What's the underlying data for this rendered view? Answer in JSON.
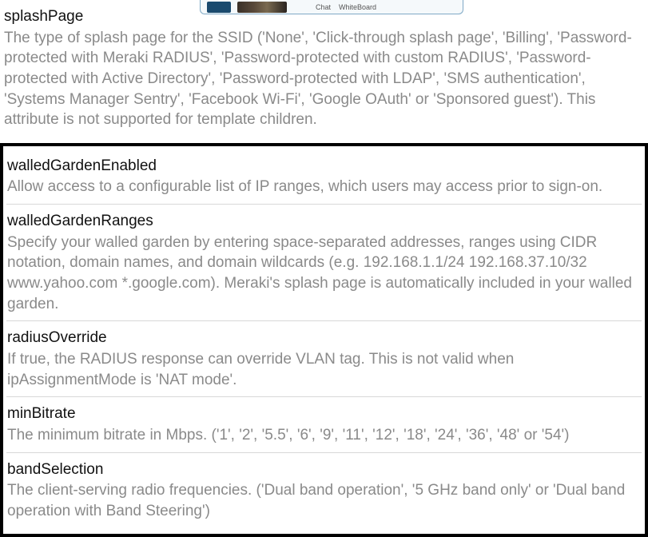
{
  "floating": {
    "chat": "Chat",
    "whiteboard": "WhiteBoard"
  },
  "top": {
    "splashPage": {
      "name": "splashPage",
      "desc": "The type of splash page for the SSID ('None', 'Click-through splash page', 'Billing', 'Password-protected with Meraki RADIUS', 'Password-protected with custom RADIUS', 'Password-protected with Active Directory', 'Password-protected with LDAP', 'SMS authentication', 'Systems Manager Sentry', 'Facebook Wi-Fi', 'Google OAuth' or 'Sponsored guest'). This attribute is not supported for template children."
    }
  },
  "bottom": {
    "walledGardenEnabled": {
      "name": "walledGardenEnabled",
      "desc": "Allow access to a configurable list of IP ranges, which users may access prior to sign-on."
    },
    "walledGardenRanges": {
      "name": "walledGardenRanges",
      "desc": "Specify your walled garden by entering space-separated addresses, ranges using CIDR notation, domain names, and domain wildcards (e.g. 192.168.1.1/24 192.168.37.10/32 www.yahoo.com *.google.com). Meraki's splash page is automatically included in your walled garden."
    },
    "radiusOverride": {
      "name": "radiusOverride",
      "desc": "If true, the RADIUS response can override VLAN tag. This is not valid when ipAssignmentMode is 'NAT mode'."
    },
    "minBitrate": {
      "name": "minBitrate",
      "desc": "The minimum bitrate in Mbps. ('1', '2', '5.5', '6', '9', '11', '12', '18', '24', '36', '48' or '54')"
    },
    "bandSelection": {
      "name": "bandSelection",
      "desc": "The client-serving radio frequencies. ('Dual band operation', '5 GHz band only' or 'Dual band operation with Band Steering')"
    }
  }
}
